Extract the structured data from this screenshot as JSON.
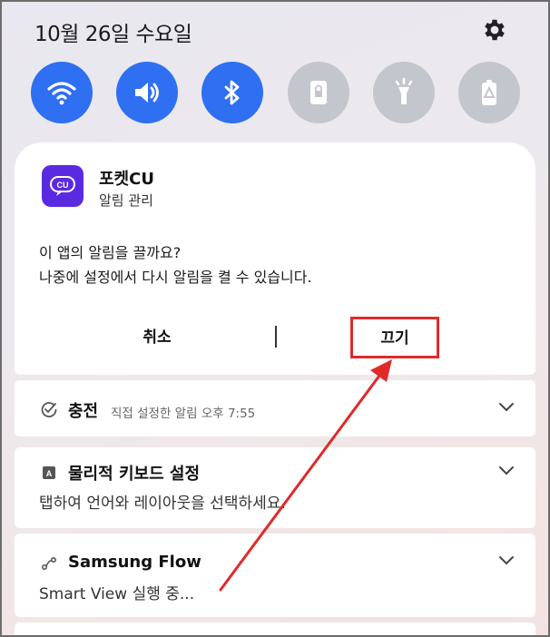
{
  "status": {
    "date": "10월 26일 수요일"
  },
  "quick_settings": [
    {
      "icon": "wifi-icon",
      "state": "on"
    },
    {
      "icon": "volume-icon",
      "state": "on"
    },
    {
      "icon": "bluetooth-icon",
      "state": "on"
    },
    {
      "icon": "lock-screen-icon",
      "state": "off"
    },
    {
      "icon": "flashlight-icon",
      "state": "off"
    },
    {
      "icon": "power-saving-icon",
      "state": "off"
    }
  ],
  "app_notification": {
    "app_name": "포켓CU",
    "app_icon_text": "CU",
    "subtitle": "알림 관리",
    "question_line1": "이 앱의 알림을 끌까요?",
    "question_line2": "나중에 설정에서 다시 알림을 켤 수 있습니다.",
    "cancel_label": "취소",
    "off_label": "끄기"
  },
  "notifications": [
    {
      "title": "충전",
      "meta": "직접 설정한 알림  오후 7:55",
      "icon": "charging-check-icon"
    },
    {
      "title": "물리적 키보드 설정",
      "body": "탭하여 언어와 레이아웃을 선택하세요.",
      "icon": "keyboard-icon"
    },
    {
      "title": "Samsung Flow",
      "body": "Smart View 실행 중...",
      "icon": "samsung-flow-icon"
    }
  ],
  "colors": {
    "accent_blue": "#2f6ff2",
    "toggle_off": "#c4c6cd",
    "annotation_red": "#e02a2a",
    "app_brand": "#5a2ae0"
  }
}
